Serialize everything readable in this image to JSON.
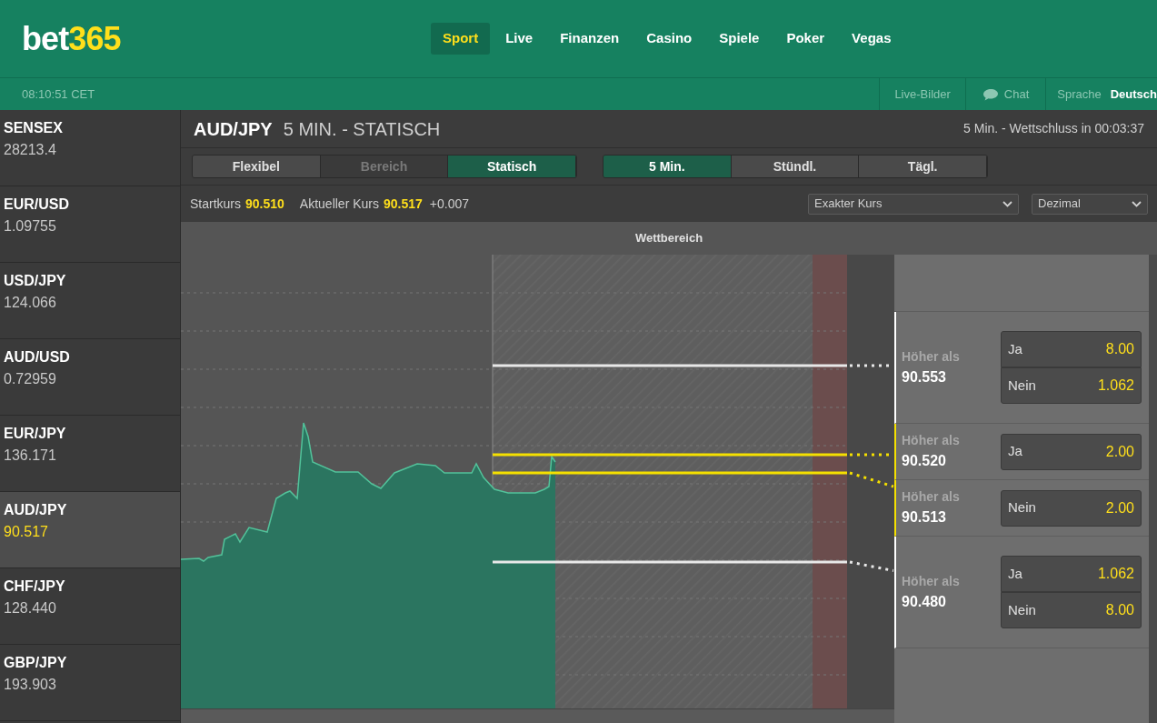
{
  "header": {
    "logo_main": "bet",
    "logo_accent": "365",
    "nav": [
      {
        "label": "Sport",
        "selected": true
      },
      {
        "label": "Live",
        "selected": false
      },
      {
        "label": "Finanzen",
        "selected": false
      },
      {
        "label": "Casino",
        "selected": false
      },
      {
        "label": "Spiele",
        "selected": false
      },
      {
        "label": "Poker",
        "selected": false
      },
      {
        "label": "Vegas",
        "selected": false
      }
    ]
  },
  "subbar": {
    "clock": "08:10:51 CET",
    "live_images": "Live-Bilder",
    "chat": "Chat",
    "language_label": "Sprache",
    "language": "Deutsch"
  },
  "sidebar": {
    "items": [
      {
        "name": "SENSEX",
        "price": "28213.4",
        "selected": false
      },
      {
        "name": "EUR/USD",
        "price": "1.09755",
        "selected": false
      },
      {
        "name": "USD/JPY",
        "price": "124.066",
        "selected": false
      },
      {
        "name": "AUD/USD",
        "price": "0.72959",
        "selected": false
      },
      {
        "name": "EUR/JPY",
        "price": "136.171",
        "selected": false
      },
      {
        "name": "AUD/JPY",
        "price": "90.517",
        "selected": true
      },
      {
        "name": "CHF/JPY",
        "price": "128.440",
        "selected": false
      },
      {
        "name": "GBP/JPY",
        "price": "193.903",
        "selected": false
      }
    ]
  },
  "market": {
    "pair": "AUD/JPY",
    "subtitle": "5 MIN. - STATISCH",
    "closing": "5 Min. - Wettschluss in 00:03:37",
    "type_tabs": [
      {
        "label": "Flexibel",
        "selected": false,
        "disabled": false
      },
      {
        "label": "Bereich",
        "selected": false,
        "disabled": true
      },
      {
        "label": "Statisch",
        "selected": true,
        "disabled": false
      }
    ],
    "period_tabs": [
      {
        "label": "5 Min.",
        "selected": true
      },
      {
        "label": "Stündl.",
        "selected": false
      },
      {
        "label": "Tägl.",
        "selected": false
      }
    ],
    "start_label": "Startkurs",
    "start_value": "90.510",
    "current_label": "Aktueller Kurs",
    "current_value": "90.517",
    "change": "+0.007",
    "dropdowns": [
      {
        "value": "Exakter Kurs"
      },
      {
        "value": "Dezimal"
      }
    ],
    "range_header": "Wettbereich",
    "markets": [
      {
        "label": "Höher als",
        "value": "90.553",
        "highlighted": false,
        "options": [
          {
            "label": "Ja",
            "odds": "8.00"
          },
          {
            "label": "Nein",
            "odds": "1.062"
          }
        ]
      },
      {
        "label": "Höher als",
        "value": "90.520",
        "highlighted": true,
        "options": [
          {
            "label": "Ja",
            "odds": "2.00"
          }
        ]
      },
      {
        "label": "Höher als",
        "value": "90.513",
        "highlighted": true,
        "options": [
          {
            "label": "Nein",
            "odds": "2.00"
          }
        ]
      },
      {
        "label": "Höher als",
        "value": "90.480",
        "highlighted": false,
        "options": [
          {
            "label": "Ja",
            "odds": "1.062"
          },
          {
            "label": "Nein",
            "odds": "8.00"
          }
        ]
      }
    ]
  }
}
